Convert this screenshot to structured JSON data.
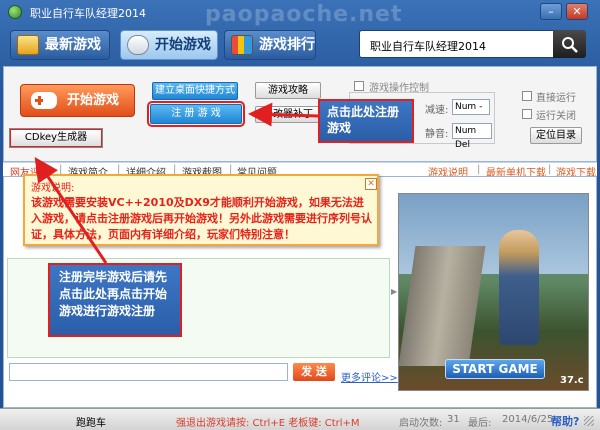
{
  "window": {
    "title": "职业自行车队经理2014",
    "watermark": "paopaoche.net",
    "minimize_glyph": "–",
    "close_glyph": "✕"
  },
  "top_tabs": [
    {
      "label": "最新游戏",
      "icon": "new-games-icon"
    },
    {
      "label": "开始游戏",
      "icon": "start-game-icon",
      "active": true
    },
    {
      "label": "游戏排行",
      "icon": "ranking-chart-icon"
    }
  ],
  "search": {
    "value": "职业自行车队经理2014",
    "icon": "search-icon"
  },
  "panel": {
    "start_game_label": "开始游戏",
    "cdkey_label": "CDkey生成器",
    "shortcut_label": "建立桌面快捷方式",
    "register_label": "注 册 游 戏",
    "guide_label": "游戏攻略",
    "tool_label": "修改器补丁",
    "control_label": "游戏操作控制",
    "speed_label": "减速:",
    "speed_value": "Num -",
    "mute_label": "静音:",
    "mute_value": "Num Del",
    "direct_run_label": "直接运行",
    "run_close_label": "运行关闭",
    "locate_label": "定位目录"
  },
  "nav": {
    "left": [
      "网友评",
      "游戏简介",
      "详细介绍",
      "游戏截图",
      "常见问题"
    ],
    "right": [
      "游戏说明",
      "最新单机下载",
      "游戏下载"
    ],
    "separator": "|"
  },
  "notice": {
    "title": "游戏说明:",
    "body": "该游戏需要安装VC++2010及DX9才能顺利开始游戏，如果无法进入游戏，请点击注册游戏后再开始游戏！另外此游戏需要进行序列号认证，具体方法，页面内有详细介绍，玩家们特别注意！",
    "close_glyph": "✕"
  },
  "callouts": {
    "register": "点击此处注册游戏",
    "finish": "注册完毕游戏后请先点击此处再点击开始游戏进行游戏注册"
  },
  "comment": {
    "send_label": "发 送",
    "more_label": "更多评论>>"
  },
  "ad": {
    "start_label": "START GAME",
    "age": "37.c"
  },
  "status": {
    "brand": "跑跑车",
    "hotkeys": "强退出游戏请按: Ctrl+E 老板键: Ctrl+M",
    "launches_label": "启动次数:",
    "launches": "31",
    "date_label": "最后:",
    "date": "2014/6/25",
    "help": "帮助?"
  },
  "colors": {
    "accent_orange": "#e24e1b",
    "button_blue": "#1f86d5",
    "notice_red": "#e6231a",
    "frame_blue": "#27579a"
  }
}
